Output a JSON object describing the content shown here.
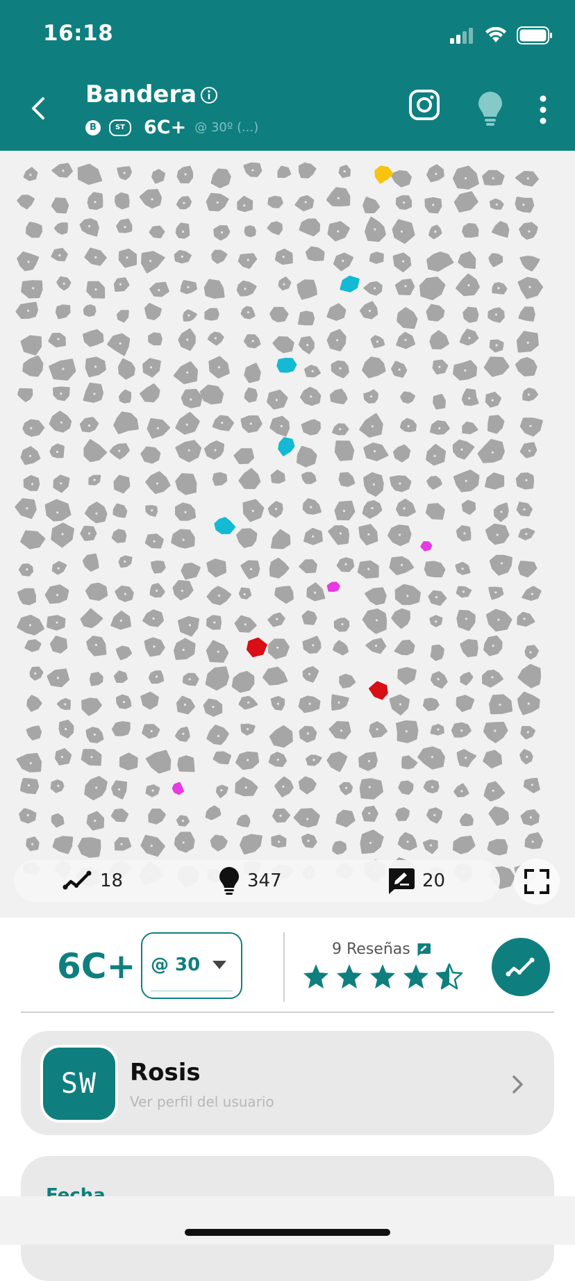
{
  "status_bar": {
    "time": "16:18"
  },
  "header": {
    "title": "Bandera",
    "badge_b": "B",
    "badge_st": "ST",
    "grade": "6C+",
    "angle_note": "@ 30º (...)"
  },
  "wall": {
    "hold_colors": {
      "start": "#14b9d3",
      "hand": "#e53be0",
      "foot": "#d80f14",
      "finish": "#f6c40f",
      "unused": "#a6a6a6"
    }
  },
  "stats": {
    "ascents": "18",
    "ideas": "347",
    "comments": "20"
  },
  "problem": {
    "grade": "6C+",
    "angle_value": "@ 30",
    "reviews_label": "9 Reseñas",
    "rating": 4.5
  },
  "setter": {
    "avatar_text": "SW",
    "name": "Rosis",
    "profile_link": "Ver perfil del usuario"
  },
  "details": {
    "date_label": "Fecha"
  },
  "colors": {
    "primary": "#0e7f7e",
    "background": "#f1f1f1"
  }
}
